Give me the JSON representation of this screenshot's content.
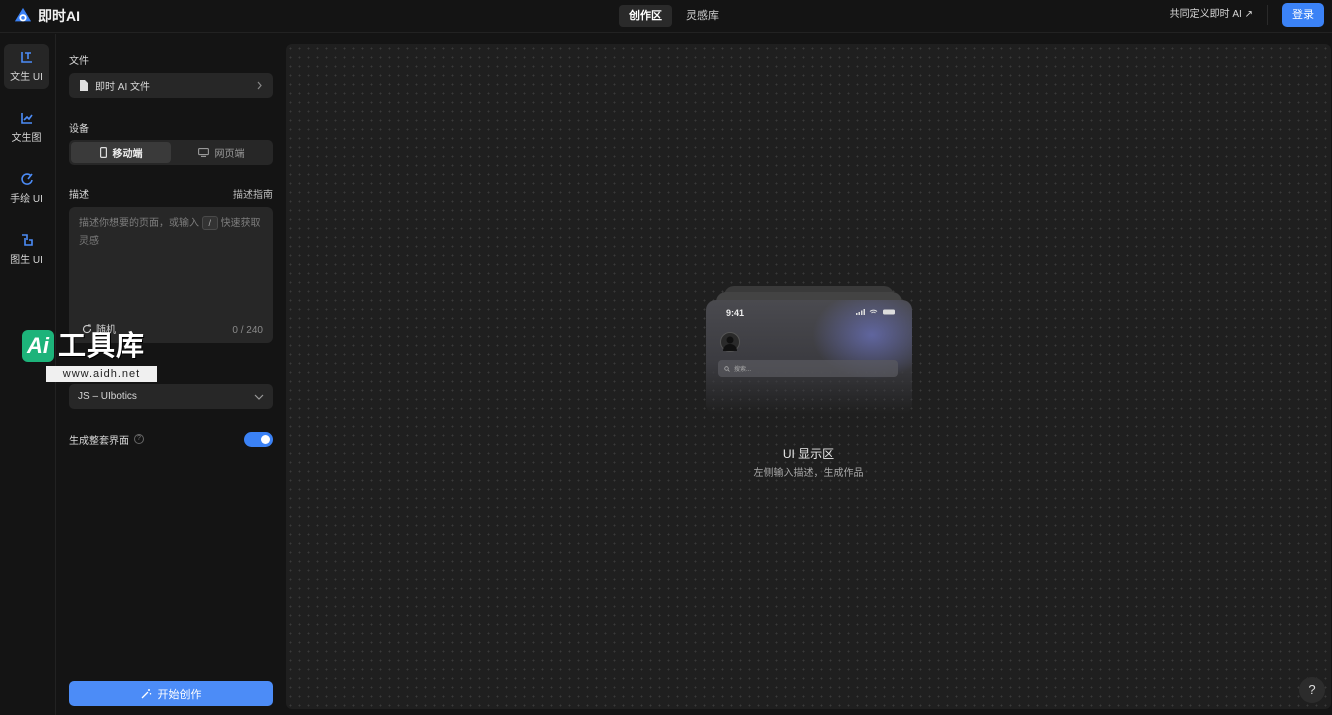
{
  "app": {
    "name": "即时AI"
  },
  "nav": {
    "tabs": [
      {
        "label": "创作区",
        "active": true
      },
      {
        "label": "灵感库",
        "active": false
      }
    ]
  },
  "topRight": {
    "define_link": "共同定义即时 AI ↗",
    "login_label": "登录"
  },
  "rail": {
    "items": [
      {
        "label": "文生 UI",
        "icon": "text-to-ui-icon",
        "active": true
      },
      {
        "label": "文生图",
        "icon": "chart-icon",
        "active": false
      },
      {
        "label": "手绘 UI",
        "icon": "sketch-icon",
        "active": false
      },
      {
        "label": "图生 UI",
        "icon": "image-to-ui-icon",
        "active": false
      }
    ]
  },
  "panel": {
    "file_title": "文件",
    "file_value": "即时 AI 文件",
    "device_title": "设备",
    "device_options": [
      {
        "label": "移动端",
        "active": true
      },
      {
        "label": "网页端",
        "active": false
      }
    ],
    "desc_title": "描述",
    "desc_guide": "描述指南",
    "desc_placeholder_a": "描述你想要的页面，或输入",
    "desc_slash": "/",
    "desc_placeholder_b": "快速获取灵感",
    "random_label": "随机",
    "counter": "0 / 240",
    "model_title": "模型",
    "model_value": "JS – UIbotics",
    "gen_full_label": "生成整套界面",
    "gen_full_on": true,
    "start_label": "开始创作"
  },
  "watermark": {
    "ai": "Ai",
    "title": "工具库",
    "url": "www.aidh.net"
  },
  "canvas": {
    "preview_time": "9:41",
    "preview_search": "搜索...",
    "title": "UI 显示区",
    "subtitle": "左侧输入描述，生成作品",
    "help": "?"
  },
  "colors": {
    "accent": "#3b82f6",
    "background": "#141414",
    "canvas": "#1f1f1f"
  }
}
